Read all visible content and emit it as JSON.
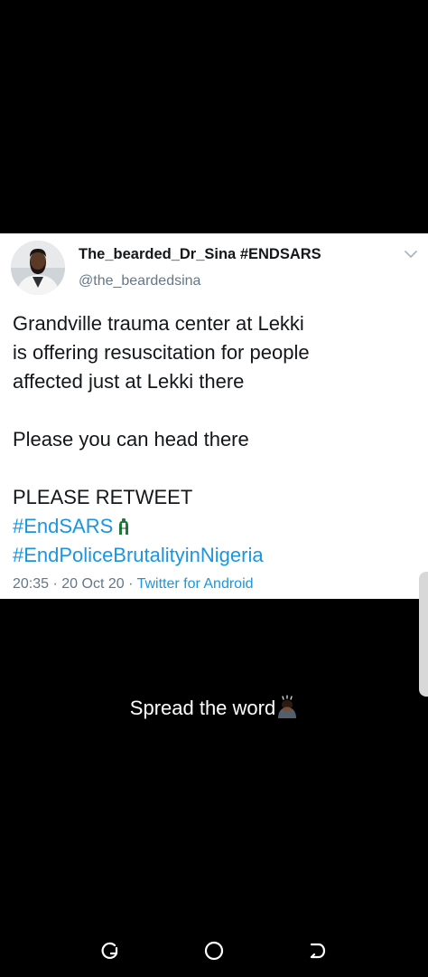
{
  "tweet": {
    "display_name": "The_bearded_Dr_Sina #ENDSARS",
    "handle": "@the_beardedsina",
    "body_lines": [
      "Grandville trauma center at Lekki",
      "is offering resuscitation for people",
      "affected just at Lekki there"
    ],
    "line2": "Please you can head there",
    "line3": "PLEASE RETWEET",
    "hashtag_1": "#EndSARS",
    "hashtag_2": "#EndPoliceBrutalityinNigeria",
    "time": "20:35",
    "date": "20 Oct 20",
    "source": "Twitter for Android",
    "separator": " · "
  },
  "caption": {
    "text": "Spread the word"
  },
  "icons": {
    "avatar": "profile-photo",
    "menu": "chevron-down-icon",
    "hashtag_emoji": "nigeria-flag-fist-icon",
    "caption_emoji": "person-bowing-icon",
    "nav": [
      "recent-apps-icon",
      "home-icon",
      "back-icon"
    ]
  },
  "colors": {
    "link": "#1b95e0",
    "secondary": "#657786",
    "text": "#14171a",
    "background": "#000000",
    "card": "#ffffff"
  }
}
